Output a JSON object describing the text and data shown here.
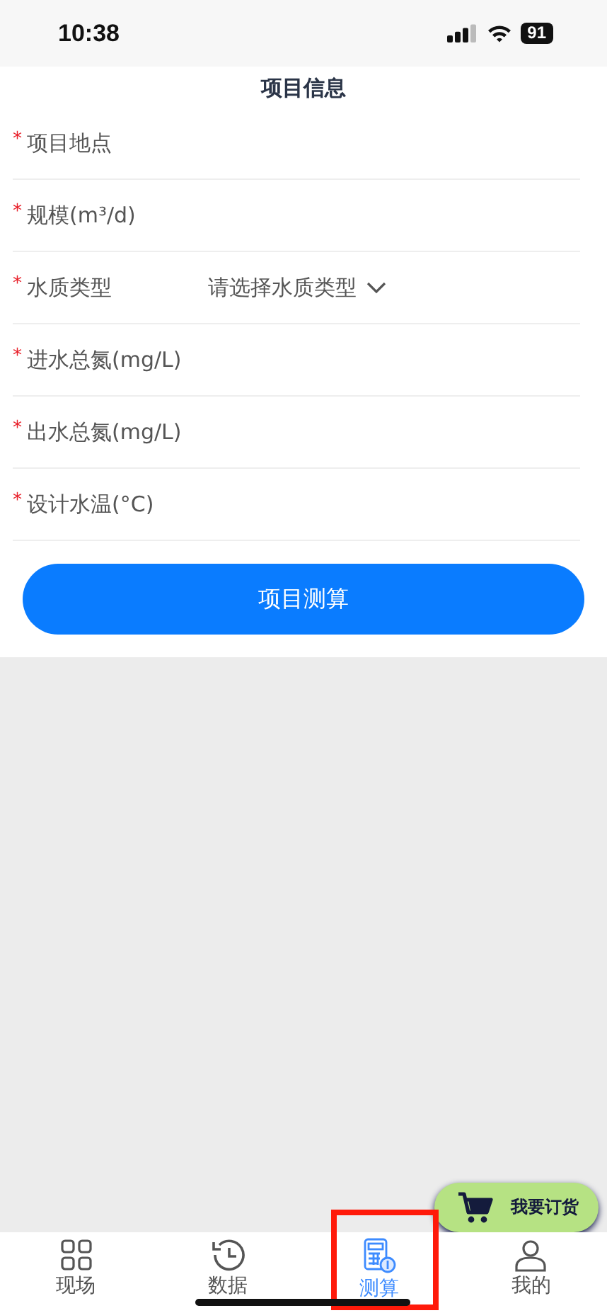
{
  "status_bar": {
    "time": "10:38",
    "battery": "91"
  },
  "title": "项目信息",
  "fields": [
    {
      "label": "项目地点",
      "required_mark": "*",
      "kind": "input"
    },
    {
      "label": "规模(m³/d)",
      "required_mark": "*",
      "kind": "input"
    },
    {
      "label": "水质类型",
      "required_mark": "*",
      "kind": "select",
      "placeholder": "请选择水质类型"
    },
    {
      "label": "进水总氮(mg/L)",
      "required_mark": "*",
      "kind": "input"
    },
    {
      "label": "出水总氮(mg/L)",
      "required_mark": "*",
      "kind": "input"
    },
    {
      "label": "设计水温(°C)",
      "required_mark": "*",
      "kind": "input"
    }
  ],
  "submit_button": "项目测算",
  "order_button": "我要订货",
  "tabs": [
    {
      "label": "现场",
      "selected": false,
      "highlighted": false
    },
    {
      "label": "数据",
      "selected": false,
      "highlighted": false
    },
    {
      "label": "测算",
      "selected": true,
      "highlighted": true
    },
    {
      "label": "我的",
      "selected": false,
      "highlighted": false
    }
  ]
}
